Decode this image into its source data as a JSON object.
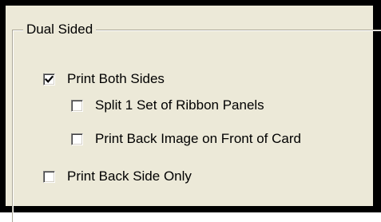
{
  "group": {
    "title": "Dual Sided"
  },
  "options": [
    {
      "label": "Print Both Sides",
      "checked": true
    },
    {
      "label": "Split 1 Set of Ribbon Panels",
      "checked": false
    },
    {
      "label": "Print Back Image on Front of Card",
      "checked": false
    },
    {
      "label": "Print Back Side Only",
      "checked": false
    }
  ]
}
